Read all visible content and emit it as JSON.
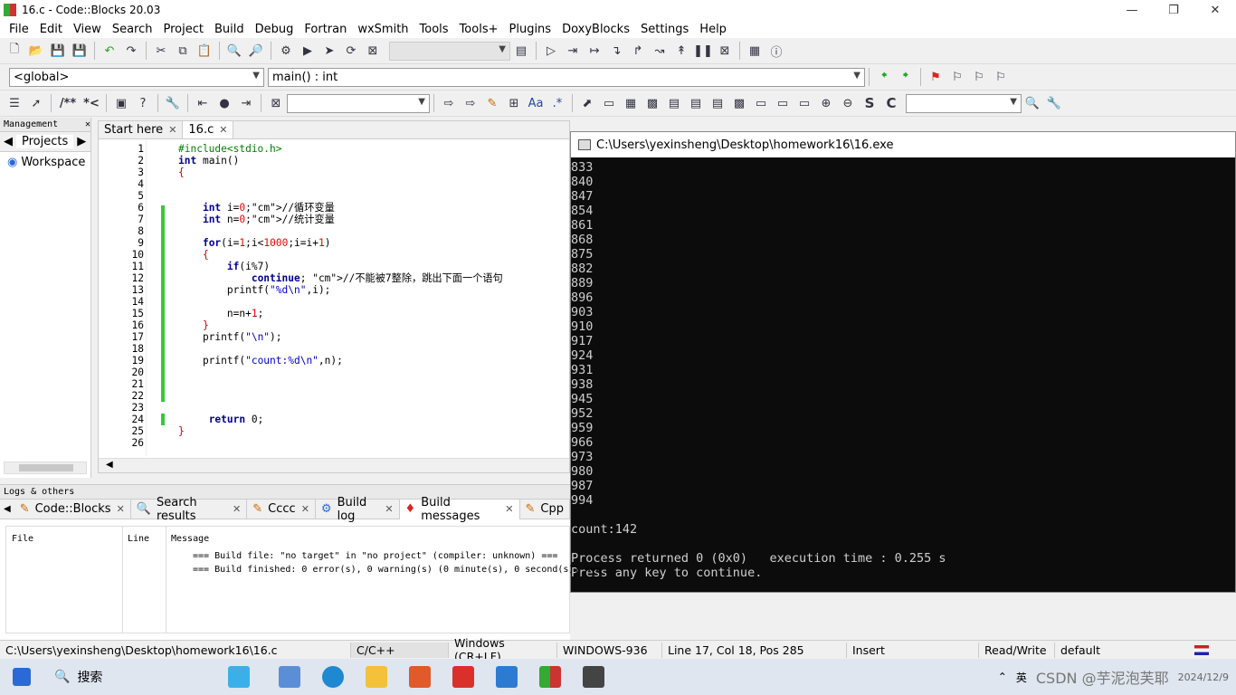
{
  "window": {
    "title": "16.c - Code::Blocks 20.03"
  },
  "menu": [
    "File",
    "Edit",
    "View",
    "Search",
    "Project",
    "Build",
    "Debug",
    "Fortran",
    "wxSmith",
    "Tools",
    "Tools+",
    "Plugins",
    "DoxyBlocks",
    "Settings",
    "Help"
  ],
  "toolbar": {
    "scope": "<global>",
    "function": "main() : int"
  },
  "toolbar3": {
    "comment_btn": "/**",
    "comment_btn2": "*<",
    "s_btn": "S",
    "c_btn": "C"
  },
  "management": {
    "title": "Management",
    "tab": "Projects",
    "item": "Workspace"
  },
  "editor": {
    "tabs": [
      "Start here",
      "16.c"
    ],
    "lines": [
      "#include<stdio.h>",
      "int main()",
      "{",
      "",
      "",
      "    int i=0;//循环变量",
      "    int n=0;//统计变量",
      "",
      "    for(i=1;i<1000;i=i+1)",
      "    {",
      "        if(i%7)",
      "            continue; //不能被7整除，跳出下面一个语句",
      "        printf(\"%d\\n\",i);",
      "",
      "        n=n+1;",
      "    }",
      "    printf(\"\\n\");",
      "",
      "    printf(\"count:%d\\n\",n);",
      "",
      "",
      "",
      "",
      "     return 0;",
      "}",
      ""
    ]
  },
  "console": {
    "title": "C:\\Users\\yexinsheng\\Desktop\\homework16\\16.exe",
    "output": [
      "833",
      "840",
      "847",
      "854",
      "861",
      "868",
      "875",
      "882",
      "889",
      "896",
      "903",
      "910",
      "917",
      "924",
      "931",
      "938",
      "945",
      "952",
      "959",
      "966",
      "973",
      "980",
      "987",
      "994",
      "",
      "count:142",
      "",
      "Process returned 0 (0x0)   execution time : 0.255 s",
      "Press any key to continue."
    ]
  },
  "logs": {
    "title": "Logs & others",
    "tabs": [
      "Code::Blocks",
      "Search results",
      "Cccc",
      "Build log",
      "Build messages",
      "Cpp"
    ],
    "columns": [
      "File",
      "Line",
      "Message"
    ],
    "messages": [
      "=== Build file: \"no target\" in \"no project\" (compiler: unknown) ===",
      "=== Build finished: 0 error(s), 0 warning(s) (0 minute(s), 0 second(s)) ==="
    ]
  },
  "status": {
    "path": "C:\\Users\\yexinsheng\\Desktop\\homework16\\16.c",
    "lang": "C/C++",
    "eol": "Windows (CR+LF)",
    "enc": "WINDOWS-936",
    "pos": "Line 17, Col 18, Pos 285",
    "mode": "Insert",
    "rw": "Read/Write",
    "profile": "default"
  },
  "taskbar": {
    "search": "搜索",
    "time": "2024/12/9",
    "lang": "英",
    "watermark": "CSDN @芋泥泡芙耶"
  }
}
